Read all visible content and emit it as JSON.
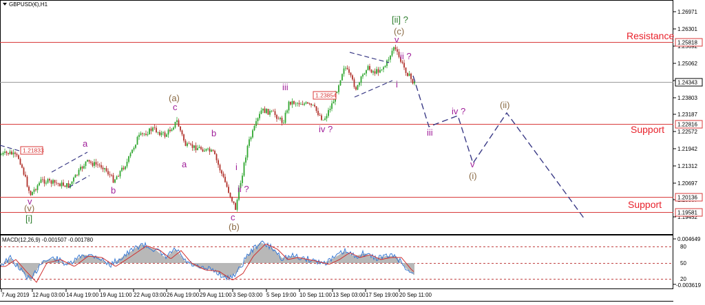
{
  "header": {
    "symbol_label": "GBPUSD(€),H1",
    "dropdown_icon": "triangle-down-icon"
  },
  "colors": {
    "level_line": "#d83a3a",
    "bull_candle": "#2ea62e",
    "bear_candle": "#b0302a",
    "wave_purple": "#a0209a",
    "wave_brown": "#8a6a44",
    "wave_green": "#2d7d2d",
    "projection": "#3a3a86",
    "zone_text": "#e8202a",
    "macd_hist": "#b8b8b8",
    "macd_main": "#3a7bd5",
    "macd_signal": "#d03030"
  },
  "price_axis": {
    "labels": [
      "1.26971",
      "1.26301",
      "1.25692",
      "1.25062",
      "1.24434",
      "1.23803",
      "1.23187",
      "1.22572",
      "1.21942",
      "1.21312",
      "1.20697",
      "1.20067",
      "1.19452"
    ],
    "tags": {
      "resistance": "1.25818",
      "current": "1.24343",
      "support_upper": "1.22816",
      "level_1": "1.20136",
      "support_lower": "1.19581"
    }
  },
  "chart_boxes": {
    "box_left": "1.21833",
    "box_mid": "1.23854"
  },
  "levels": {
    "resistance_label": "Resistance",
    "support_upper_label": "Support",
    "support_lower_label": "Support"
  },
  "wave_labels": {
    "ii_bracket": "[ii] ?",
    "c_paren": "(c)",
    "v_top": "v",
    "ii_q": "ii ?",
    "i_small": "i",
    "iii": "iii",
    "iv_q": "iv ?",
    "iii_proj": "iii",
    "iv_q_proj": "iv ?",
    "ii_paren": "(ii)",
    "v_proj": "v",
    "i_paren": "(i)",
    "a_paren": "(a)",
    "c_a": "c",
    "a_left": "a",
    "b_left": "b",
    "a_mid": "a",
    "b_mid": "b",
    "i_mid": "i",
    "ii_mid": "ii ?",
    "c_bottom": "c",
    "b_paren": "(b)",
    "v_left": "v",
    "v_paren": "(v)",
    "i_bracket": "[i]"
  },
  "macd": {
    "label": "MACD(12,26,9) -0.001507 -0.001780",
    "axis_labels": [
      "0.004649",
      "80",
      "50",
      "20",
      "-0.003619"
    ]
  },
  "time_axis": {
    "labels": [
      "7 Aug 2019",
      "12 Aug 03:00",
      "14 Aug 19:00",
      "19 Aug 11:00",
      "22 Aug 03:00",
      "26 Aug 19:00",
      "29 Aug 11:00",
      "3 Sep 03:00",
      "5 Sep 19:00",
      "10 Sep 11:00",
      "13 Sep 03:00",
      "17 Sep 19:00",
      "20 Sep 11:00"
    ]
  }
}
